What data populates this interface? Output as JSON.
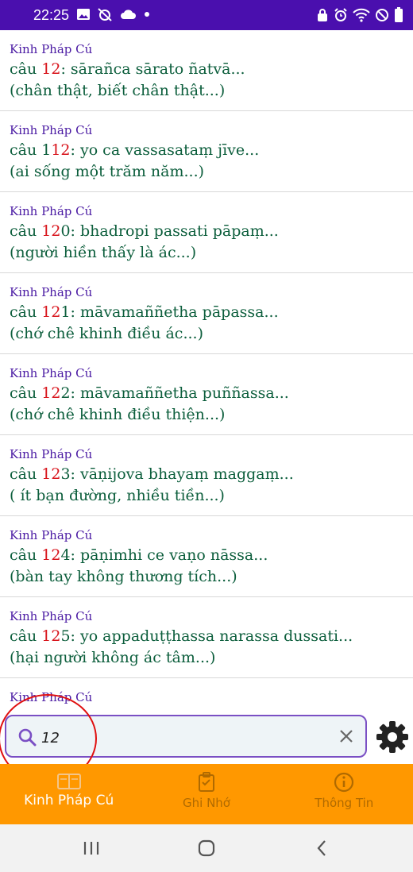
{
  "status_bar": {
    "time": "22:25",
    "left_icons": [
      "image-icon",
      "alarm-off-icon",
      "cloud-icon",
      "dot-icon"
    ],
    "right_icons": [
      "lock-icon",
      "alarm-icon",
      "wifi-icon",
      "dnd-icon",
      "battery-icon"
    ]
  },
  "results": [
    {
      "book": "Kinh Pháp Cú",
      "prefix": "câu ",
      "match": "12",
      "rest": "",
      "pali": ": sārañca sārato ñatvā...",
      "gloss": "(chân thật, biết chân thật...)"
    },
    {
      "book": "Kinh Pháp Cú",
      "prefix": "câu 1",
      "match": "12",
      "rest": "",
      "pali": ": yo ca vassasataṃ jīve...",
      "gloss": "(ai sống một trăm năm...)"
    },
    {
      "book": "Kinh Pháp Cú",
      "prefix": "câu ",
      "match": "12",
      "rest": "0",
      "pali": ": bhadropi passati pāpaṃ...",
      "gloss": "(người hiền thấy là ác...)"
    },
    {
      "book": "Kinh Pháp Cú",
      "prefix": "câu ",
      "match": "12",
      "rest": "1",
      "pali": ": māvamaññetha pāpassa...",
      "gloss": "(chớ chê khinh điều ác...)"
    },
    {
      "book": "Kinh Pháp Cú",
      "prefix": "câu ",
      "match": "12",
      "rest": "2",
      "pali": ": māvamaññetha puññassa...",
      "gloss": "(chớ chê khinh điều thiện...)"
    },
    {
      "book": "Kinh Pháp Cú",
      "prefix": "câu ",
      "match": "12",
      "rest": "3",
      "pali": ": vāṇijova bhayaṃ maggaṃ...",
      "gloss": "( ít bạn đường, nhiều tiền...)"
    },
    {
      "book": "Kinh Pháp Cú",
      "prefix": "câu ",
      "match": "12",
      "rest": "4",
      "pali": ": pāṇimhi ce vaṇo nāssa...",
      "gloss": "(bàn tay không thương tích...)"
    },
    {
      "book": "Kinh Pháp Cú",
      "prefix": "câu ",
      "match": "12",
      "rest": "5",
      "pali": ": yo appaduṭṭhassa narassa dussati...",
      "gloss": "(hại người không ác tâm...)"
    },
    {
      "book": "Kinh Pháp Cú",
      "prefix": "",
      "match": "",
      "rest": "",
      "pali": "",
      "gloss": ""
    }
  ],
  "search": {
    "value": "12",
    "icon": "search-icon",
    "clear_icon": "close-icon",
    "settings_icon": "gear-icon"
  },
  "bottom_nav": {
    "tabs": [
      {
        "label": "Kinh Pháp Cú",
        "icon": "book-icon",
        "active": true
      },
      {
        "label": "Ghi Nhớ",
        "icon": "clipboard-icon",
        "active": false
      },
      {
        "label": "Thông Tin",
        "icon": "info-icon",
        "active": false
      }
    ]
  },
  "colors": {
    "status_bar": "#4a0fae",
    "book_title": "#4a1aa3",
    "verse_text": "#0c5e3c",
    "highlight": "#d8141c",
    "nav_bg": "#ff9800",
    "search_border": "#7a4fc4",
    "annotation": "#e01010"
  }
}
